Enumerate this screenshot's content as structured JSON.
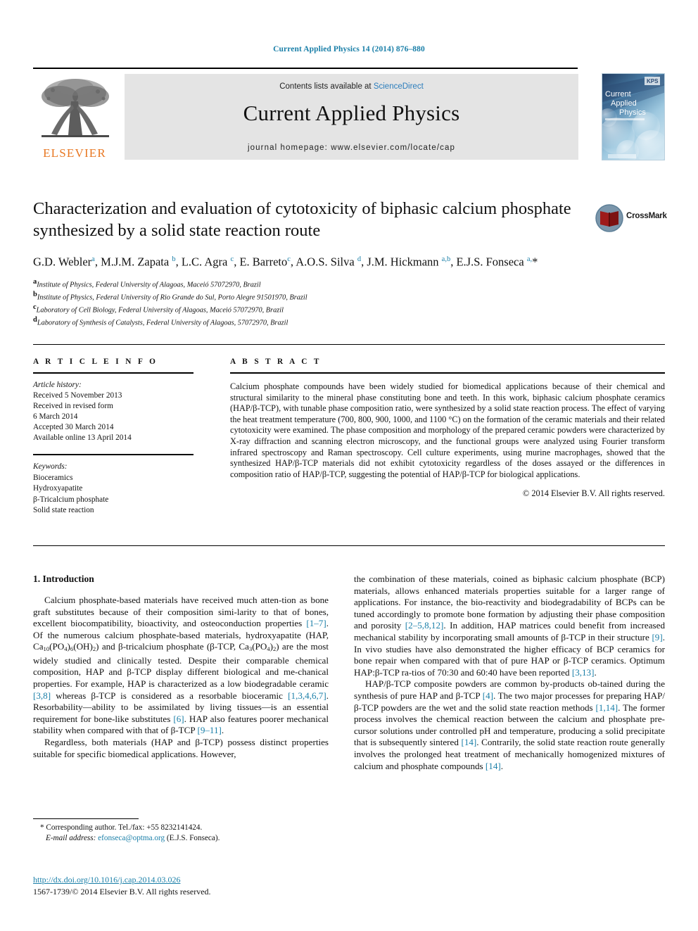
{
  "running_head": "Current Applied Physics 14 (2014) 876–880",
  "masthead": {
    "contents_prefix": "Contents lists available at ",
    "sciencedirect": "ScienceDirect",
    "journal_title": "Current Applied Physics",
    "homepage": "journal homepage: www.elsevier.com/locate/cap",
    "publisher_wordmark": "ELSEVIER",
    "cover_title_line1": "Current",
    "cover_title_line2": "Applied",
    "cover_title_line3": "Physics",
    "cover_badge": "KPS"
  },
  "crossmark": {
    "label": "CrossMark"
  },
  "article": {
    "title": "Characterization and evaluation of cytotoxicity of biphasic calcium phosphate synthesized by a solid state reaction route",
    "authors_html": "G.D. Webler<sup>a</sup>, M.J.M. Zapata <sup>b</sup>, L.C. Agra <sup>c</sup>, E. Barreto<sup>c</sup>, A.O.S. Silva <sup>d</sup>, J.M. Hickmann <sup>a,b</sup>, E.J.S. Fonseca <sup>a,</sup>*",
    "affiliations": [
      {
        "marker": "a",
        "text": "Institute of Physics, Federal University of Alagoas, Maceió 57072970, Brazil"
      },
      {
        "marker": "b",
        "text": "Institute of Physics, Federal University of Rio Grande do Sul, Porto Alegre 91501970, Brazil"
      },
      {
        "marker": "c",
        "text": "Laboratory of Cell Biology, Federal University of Alagoas, Maceió 57072970, Brazil"
      },
      {
        "marker": "d",
        "text": "Laboratory of Synthesis of Catalysts, Federal University of Alagoas, 57072970, Brazil"
      }
    ]
  },
  "article_info": {
    "heading": "A R T I C L E    I N F O",
    "history_label": "Article history:",
    "history": [
      "Received 5 November 2013",
      "Received in revised form",
      "6 March 2014",
      "Accepted 30 March 2014",
      "Available online 13 April 2014"
    ],
    "keywords_label": "Keywords:",
    "keywords": [
      "Bioceramics",
      "Hydroxyapatite",
      "β-Tricalcium phosphate",
      "Solid state reaction"
    ]
  },
  "abstract": {
    "heading": "A B S T R A C T",
    "text": "Calcium phosphate compounds have been widely studied for biomedical applications because of their chemical and structural similarity to the mineral phase constituting bone and teeth. In this work, biphasic calcium phosphate ceramics (HAP/β-TCP), with tunable phase composition ratio, were synthesized by a solid state reaction process. The effect of varying the heat treatment temperature (700, 800, 900, 1000, and 1100 °C) on the formation of the ceramic materials and their related cytotoxicity were examined. The phase composition and morphology of the prepared ceramic powders were characterized by X-ray diffraction and scanning electron microscopy, and the functional groups were analyzed using Fourier transform infrared spectroscopy and Raman spectroscopy. Cell culture experiments, using murine macrophages, showed that the synthesized HAP/β-TCP materials did not exhibit cytotoxicity regardless of the doses assayed or the differences in composition ratio of HAP/β-TCP, suggesting the potential of HAP/β-TCP for biological applications.",
    "copyright": "© 2014 Elsevier B.V. All rights reserved."
  },
  "body": {
    "section_title": "1. Introduction",
    "left_paragraph_1_html": "Calcium phosphate-based materials have received much atten-tion as bone graft substitutes because of their composition simi-larity to that of bones, excellent biocompatibility, bioactivity, and osteoconduction properties <span class=\"cite\">[1&ndash;7]</span>. Of the numerous calcium phosphate-based materials, hydroxyapatite (HAP, Ca<sub>10</sub>(PO<sub>4</sub>)<sub>6</sub>(OH)<sub>2</sub>) and &beta;-tricalcium phosphate (&beta;-TCP, Ca<sub>3</sub>(PO<sub>4</sub>)<sub>2</sub>) are the most widely studied and clinically tested. Despite their comparable chemical composition, HAP and &beta;-TCP display different biological and me-chanical properties. For example, HAP is characterized as a low biodegradable ceramic <span class=\"cite\">[3,8]</span> whereas &beta;-TCP is considered as a resorbable bioceramic <span class=\"cite\">[1,3,4,6,7]</span>. Resorbability&mdash;ability to be assimilated by living tissues&mdash;is an essential requirement for bone-like substitutes <span class=\"cite\">[6]</span>. HAP also features poorer mechanical stability when compared with that of &beta;-TCP <span class=\"cite\">[9&ndash;11]</span>.",
    "left_paragraph_2_html": "Regardless, both materials (HAP and &beta;-TCP) possess distinct properties suitable for specific biomedical applications. However,",
    "right_paragraph_1_html": "the combination of these materials, coined as biphasic calcium phosphate (BCP) materials, allows enhanced materials properties suitable for a larger range of applications. For instance, the bio-reactivity and biodegradability of BCPs can be tuned accordingly to promote bone formation by adjusting their phase composition and porosity <span class=\"cite\">[2&ndash;5,8,12]</span>. In addition, HAP matrices could benefit from increased mechanical stability by incorporating small amounts of &beta;-TCP in their structure <span class=\"cite\">[9]</span>. In vivo studies have also demonstrated the higher efficacy of BCP ceramics for bone repair when compared with that of pure HAP or &beta;-TCP ceramics. Optimum HAP:&beta;-TCP ra-tios of 70:30 and 60:40 have been reported <span class=\"cite\">[3,13]</span>.",
    "right_paragraph_2_html": "HAP/&beta;-TCP composite powders are common by-products ob-tained during the synthesis of pure HAP and &beta;-TCP <span class=\"cite\">[4]</span>. The two major processes for preparing HAP/&beta;-TCP powders are the wet and the solid state reaction methods <span class=\"cite\">[1,14]</span>. The former process involves the chemical reaction between the calcium and phosphate pre-cursor solutions under controlled pH and temperature, producing a solid precipitate that is subsequently sintered <span class=\"cite\">[14]</span>. Contrarily, the solid state reaction route generally involves the prolonged heat treatment of mechanically homogenized mixtures of calcium and phosphate compounds <span class=\"cite\">[14]</span>."
  },
  "footer": {
    "corresponding_author": "* Corresponding author. Tel./fax: +55 8232141424.",
    "email_label": "E-mail address:",
    "email": "efonseca@optma.org",
    "email_suffix": "(E.J.S. Fonseca).",
    "doi": "http://dx.doi.org/10.1016/j.cap.2014.03.026",
    "issn_line": "1567-1739/© 2014 Elsevier B.V. All rights reserved."
  },
  "colors": {
    "link": "#1a7fa8",
    "sciencedirect": "#2b7dbc",
    "elsevier_orange": "#e87722",
    "masthead_bg": "#e4e4e4"
  }
}
